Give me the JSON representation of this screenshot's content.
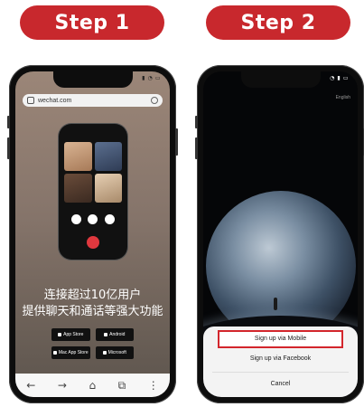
{
  "steps": {
    "step1_label": "Step 1",
    "step2_label": "Step 2"
  },
  "phone1": {
    "url": "wechat.com",
    "headline_line1": "连接超过10亿用户",
    "headline_line2": "提供聊天和通话等强大功能",
    "store_badges": [
      {
        "label": "App Store"
      },
      {
        "label": "Android"
      },
      {
        "label": "Mac App Store"
      },
      {
        "label": "Microsoft"
      }
    ],
    "nav_icons": [
      "back-arrow",
      "forward-arrow",
      "home",
      "tabs",
      "more"
    ]
  },
  "phone2": {
    "language_link": "English",
    "options": {
      "signup_mobile": "Sign up via Mobile",
      "signup_facebook": "Sign up via  Facebook",
      "cancel": "Cancel"
    },
    "highlight_color": "#d3262c"
  },
  "colors": {
    "accent": "#c8282d"
  }
}
